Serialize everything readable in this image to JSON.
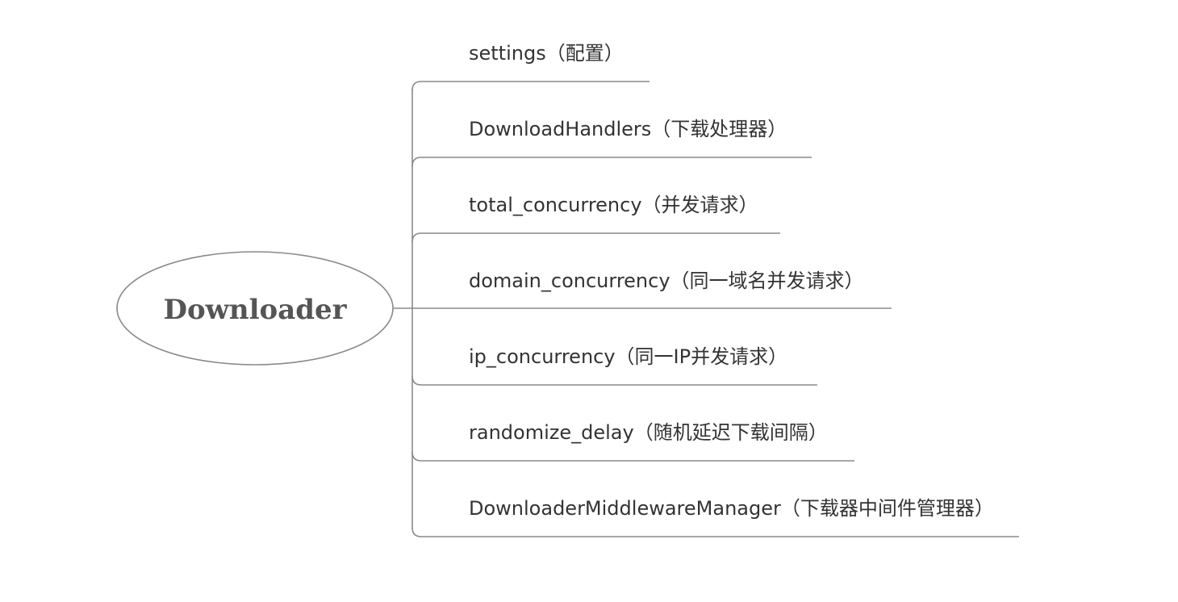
{
  "root": {
    "label": "Downloader"
  },
  "branches": [
    {
      "label": "settings（配置）"
    },
    {
      "label": "DownloadHandlers（下载处理器）"
    },
    {
      "label": "total_concurrency（并发请求）"
    },
    {
      "label": "domain_concurrency（同一域名并发请求）"
    },
    {
      "label": "ip_concurrency（同一IP并发请求）"
    },
    {
      "label": "randomize_delay（随机延迟下载间隔）"
    },
    {
      "label": "DownloaderMiddlewareManager（下载器中间件管理器）"
    }
  ],
  "colors": {
    "line": "#8a8a8a",
    "root_text": "#555555",
    "branch_text": "#333333",
    "background": "#ffffff"
  }
}
